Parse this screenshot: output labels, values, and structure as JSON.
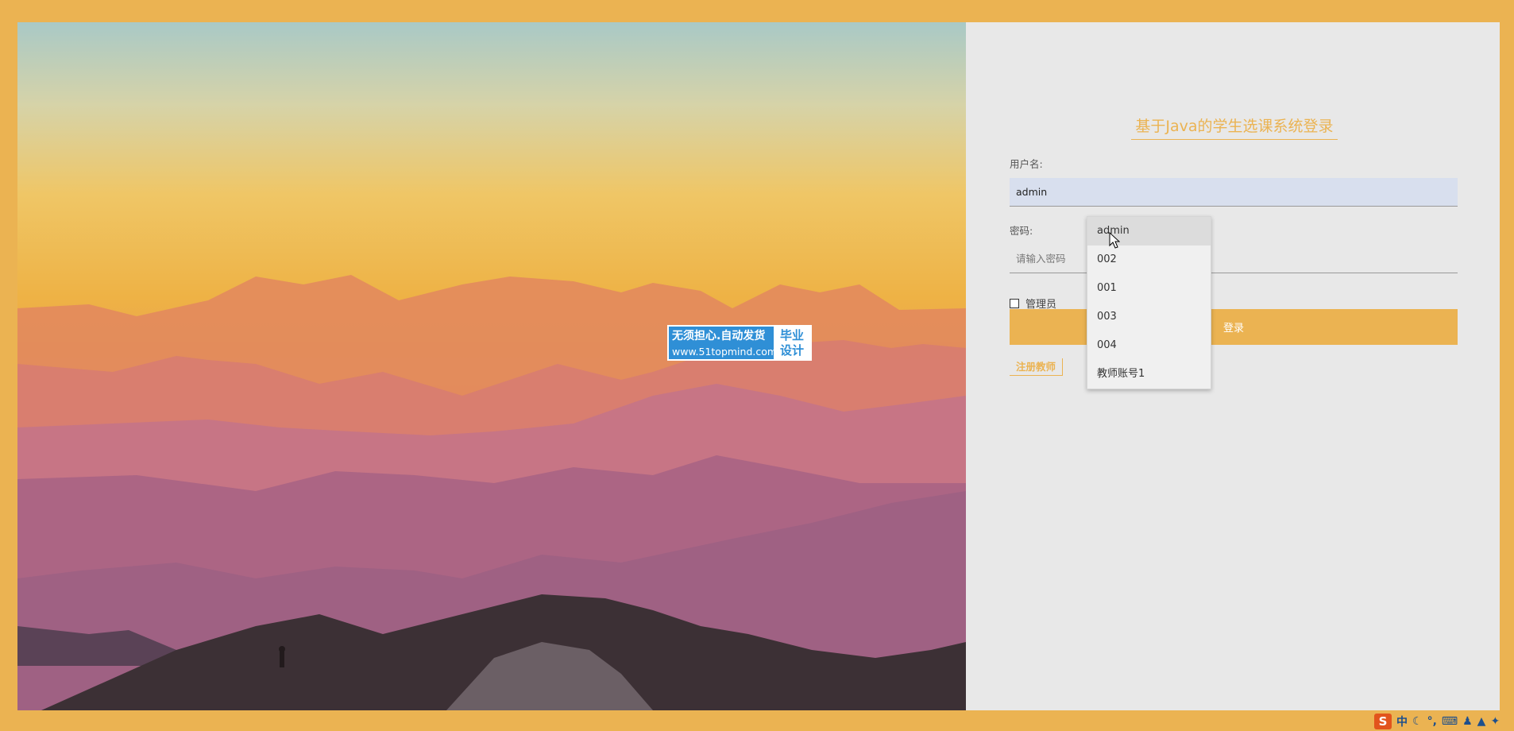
{
  "login": {
    "title": "基于Java的学生选课系统登录",
    "username_label": "用户名:",
    "username_value": "admin",
    "password_label": "密码:",
    "password_placeholder": "请输入密码",
    "role_admin_label": "管理员",
    "login_button": "登录",
    "register_link": "注册教师"
  },
  "autocomplete": {
    "options": [
      "admin",
      "002",
      "001",
      "003",
      "004",
      "教师账号1"
    ],
    "highlighted": "admin"
  },
  "watermark": {
    "line1": "无须担心.自动发货",
    "line2": "www.51topmind.com",
    "badge_line1": "毕业",
    "badge_line2": "设计"
  },
  "taskbar": {
    "ime_logo": "S",
    "ime_mode": "中",
    "icons": [
      "moon-icon",
      "punctuation-icon",
      "keyboard-icon",
      "user-icon",
      "shirt-icon",
      "wrench-icon"
    ]
  },
  "colors": {
    "accent": "#ebb352",
    "panel_bg": "#e8e8e8",
    "input_autofill_bg": "#d8dfee"
  }
}
